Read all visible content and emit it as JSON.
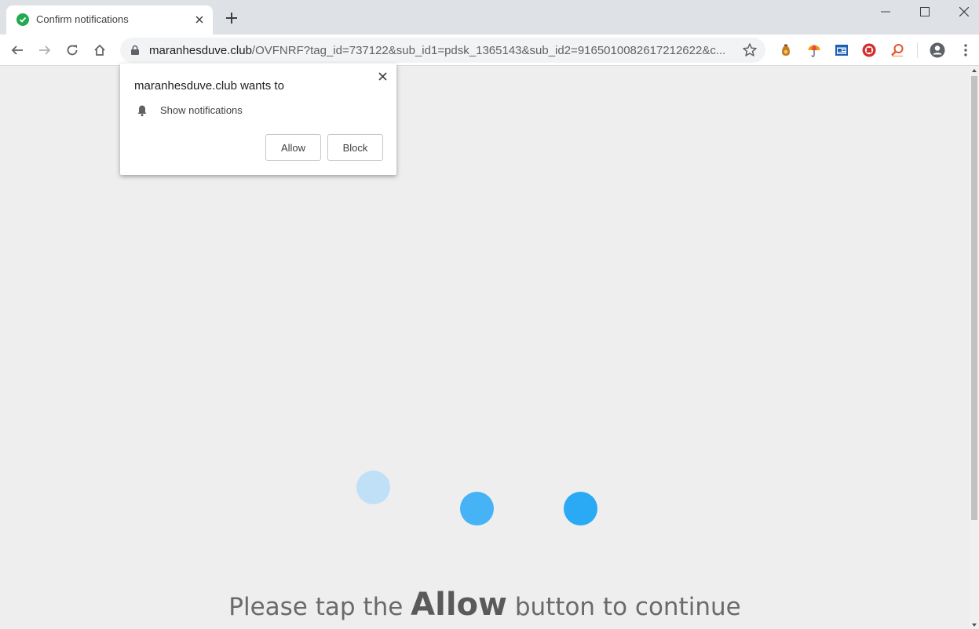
{
  "tab": {
    "title": "Confirm notifications",
    "favicon": "check-circle-icon",
    "favicon_color": "#23a94f"
  },
  "window": {
    "controls": [
      "minimize-icon",
      "maximize-icon",
      "close-icon"
    ]
  },
  "toolbar": {
    "url_host": "maranhesduve.club",
    "url_rest": "/OVFNRF?tag_id=737122&sub_id1=pdsk_1365143&sub_id2=9165010082617212622&c...",
    "extensions": [
      "bag-extension-icon",
      "umbrella-extension-icon",
      "window-extension-icon",
      "red-film-extension-icon",
      "magnifier-extension-icon"
    ]
  },
  "popup": {
    "title": "maranhesduve.club wants to",
    "permission": "Show notifications",
    "allow_label": "Allow",
    "block_label": "Block"
  },
  "content": {
    "cta_prefix": "Please tap the ",
    "cta_strong": "Allow",
    "cta_suffix": " button to continue",
    "dot_colors": [
      "#bfe0f6",
      "#45b3f6",
      "#2aa9f5"
    ]
  }
}
